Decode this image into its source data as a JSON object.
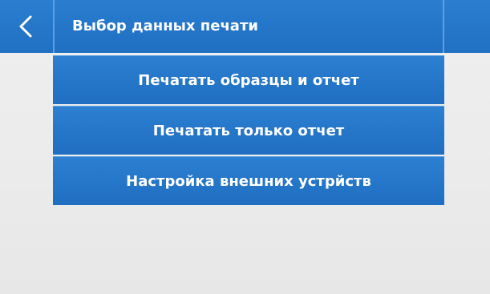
{
  "header": {
    "back_icon": "chevron-left-icon",
    "title": "Выбор данных печати"
  },
  "menu": {
    "items": [
      {
        "label": "Печатать образцы и отчет"
      },
      {
        "label": "Печатать только отчет"
      },
      {
        "label": "Настройка внешних устрйств"
      }
    ]
  },
  "colors": {
    "accent": "#2070c3",
    "background": "#ededed",
    "text": "#ffffff"
  }
}
